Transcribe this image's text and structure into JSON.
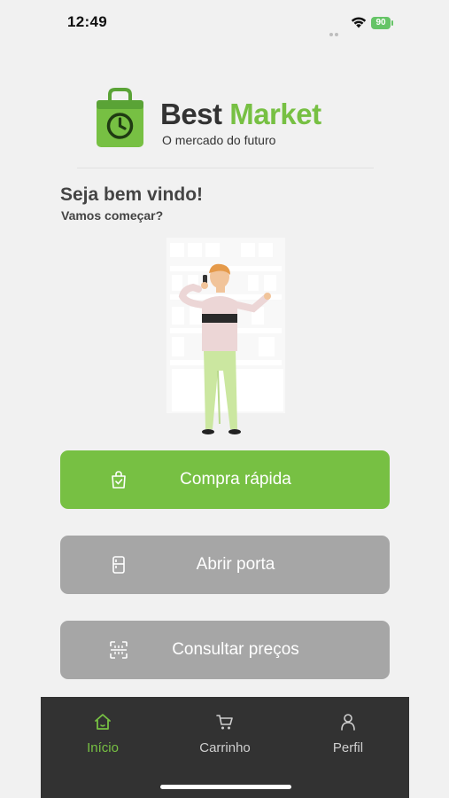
{
  "status_bar": {
    "time": "12:49",
    "battery": "90"
  },
  "brand": {
    "name_part1": "Best",
    "name_part2": "Market",
    "tagline": "O mercado do futuro",
    "accent_color": "#77c043",
    "logo_icon": "shopping-bag-clock-icon"
  },
  "welcome": {
    "title": "Seja bem vindo!",
    "subtitle": "Vamos começar?"
  },
  "actions": [
    {
      "label": "Compra rápida",
      "icon": "shopping-bag-icon",
      "color": "#77c043"
    },
    {
      "label": "Abrir porta",
      "icon": "fridge-door-icon",
      "color": "#a6a6a6"
    },
    {
      "label": "Consultar preços",
      "icon": "scan-barcode-icon",
      "color": "#a6a6a6"
    }
  ],
  "tab_bar": {
    "tabs": [
      {
        "label": "Início",
        "icon": "home-icon",
        "active": true
      },
      {
        "label": "Carrinho",
        "icon": "cart-icon",
        "active": false
      },
      {
        "label": "Perfil",
        "icon": "user-icon",
        "active": false
      }
    ],
    "active_color": "#77c043",
    "background": "#323232"
  }
}
